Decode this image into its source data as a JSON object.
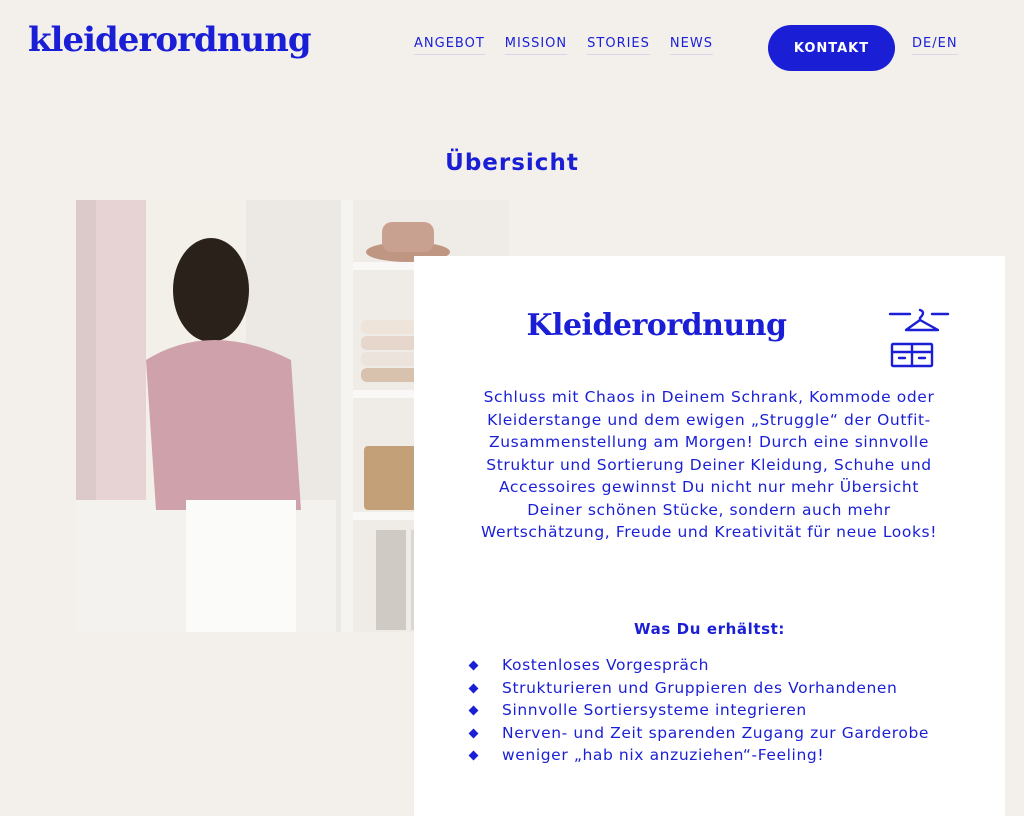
{
  "header": {
    "logo": "kleiderordnung",
    "nav": [
      "ANGEBOT",
      "MISSION",
      "STORIES",
      "NEWS"
    ],
    "contact_button": "KONTAKT",
    "language": "DE/EN"
  },
  "section": {
    "title": "Übersicht"
  },
  "card": {
    "title": "Kleiderordnung",
    "icon": "wardrobe-hanger-icon",
    "description": "Schluss mit Chaos in Deinem Schrank, Kommode oder Kleiderstange und dem ewigen „Struggle“ der Outfit-Zusammenstellung am Morgen! Durch eine sinnvolle Struktur und Sortierung Deiner Kleidung, Schuhe und Accessoires gewinnst Du nicht nur mehr Übersicht Deiner schönen Stücke, sondern auch mehr Wertschätzung, Freude und Kreativität für neue Looks!",
    "subtitle": "Was Du erhältst:",
    "benefits": [
      "Kostenloses Vorgespräch",
      "Strukturieren und Gruppieren des Vorhandenen",
      "Sinnvolle Sortiersysteme integrieren",
      "Nerven- und Zeit sparenden Zugang zur Garderobe",
      "weniger „hab nix anzuziehen“-Feeling!"
    ]
  },
  "colors": {
    "accent": "#1a1fd6",
    "background": "#f3f0ec",
    "card": "#ffffff"
  }
}
